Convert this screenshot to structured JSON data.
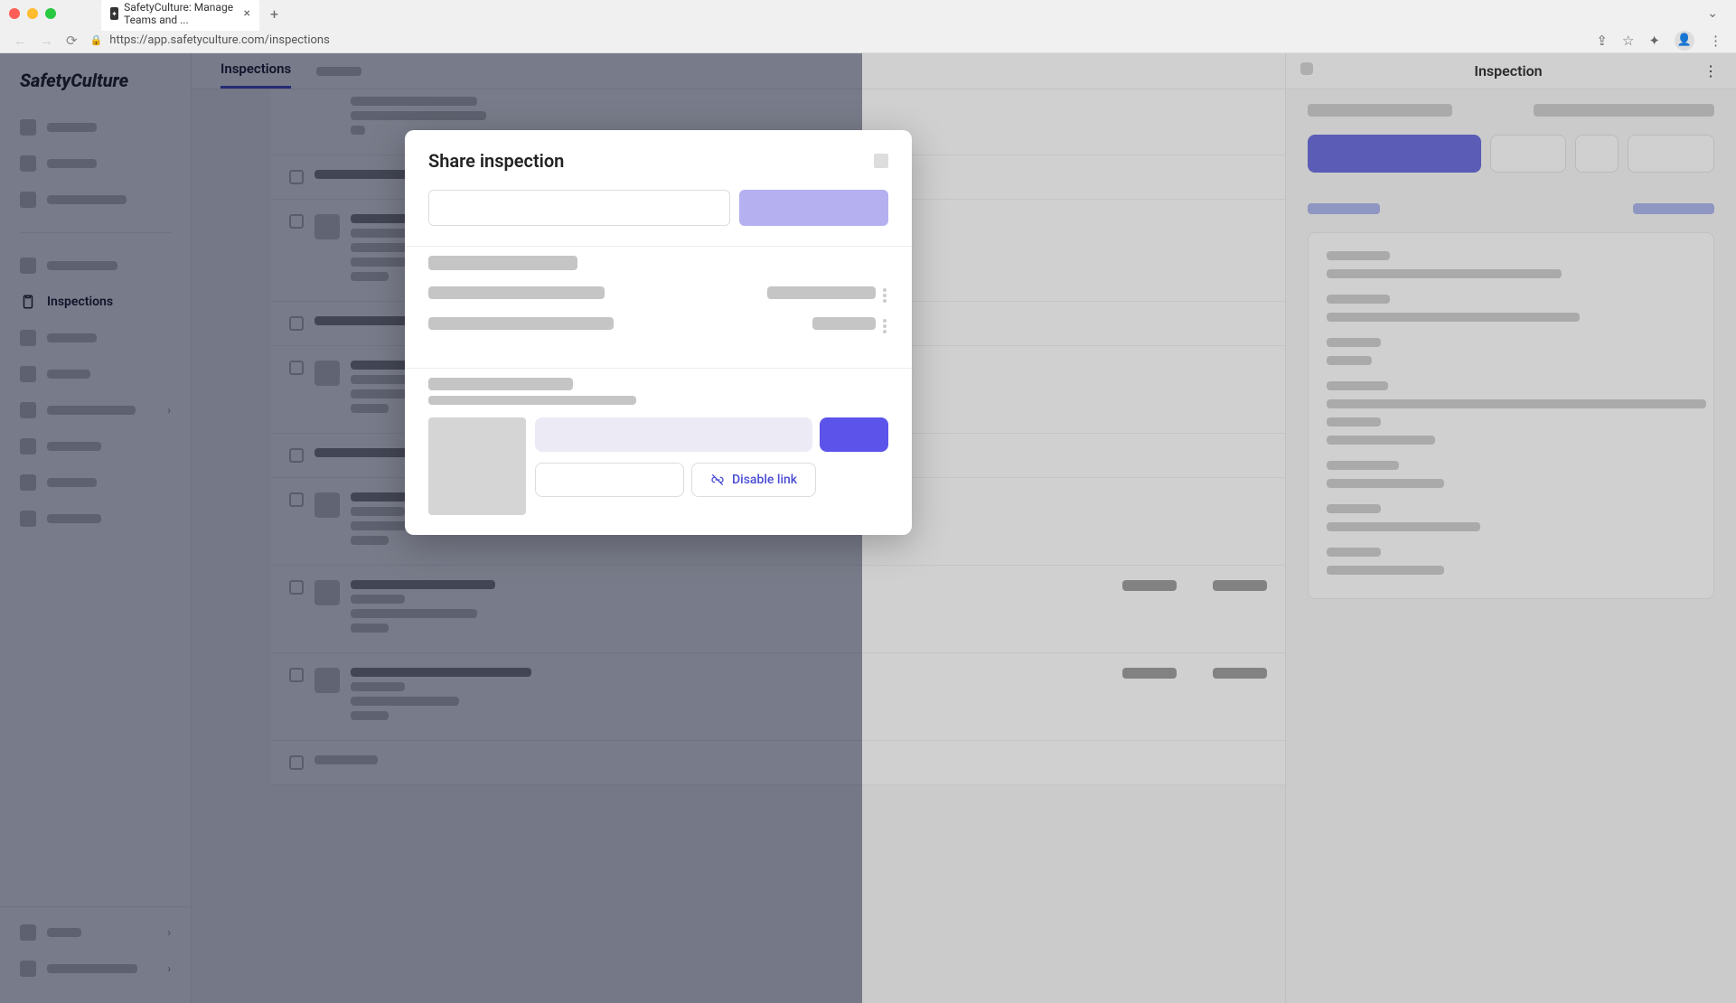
{
  "browser": {
    "tab_title": "SafetyCulture: Manage Teams and ...",
    "url": "https://app.safetyculture.com/inspections"
  },
  "brand": "SafetyCulture",
  "sidebar": {
    "active_item_label": "Inspections"
  },
  "main_tabs": {
    "active_label": "Inspections"
  },
  "right_panel": {
    "title": "Inspection"
  },
  "modal": {
    "title": "Share inspection",
    "disable_link_label": "Disable link"
  },
  "colors": {
    "accent": "#4a4dd6",
    "accent_bright": "#5b53ea",
    "accent_light": "#b5b0ef"
  }
}
